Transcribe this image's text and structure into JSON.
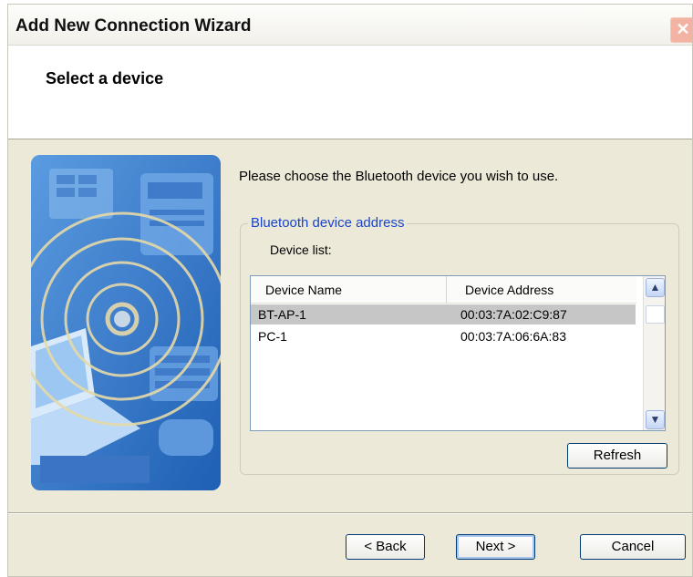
{
  "window": {
    "title": "Add New Connection Wizard",
    "close_glyph": "✕"
  },
  "header": {
    "title": "Select a device"
  },
  "main": {
    "intro": "Please choose the Bluetooth device you wish to use.",
    "group_label": "Bluetooth device address",
    "device_list_label": "Device list:",
    "columns": [
      "Device Name",
      "Device Address"
    ],
    "rows": [
      {
        "name": "BT-AP-1",
        "address": "00:03:7A:02:C9:87",
        "selected": true
      },
      {
        "name": "PC-1",
        "address": "00:03:7A:06:6A:83",
        "selected": false
      }
    ],
    "refresh_label": "Refresh"
  },
  "footer": {
    "back_label": "< Back",
    "next_label": "Next >",
    "cancel_label": "Cancel"
  },
  "icons": {
    "scroll_up": "chevron-up-icon",
    "scroll_down": "chevron-down-icon",
    "close": "close-icon"
  },
  "colors": {
    "accent": "#1a45c8",
    "window_bg": "#ece9d8",
    "selection": "#c7c6c6"
  }
}
